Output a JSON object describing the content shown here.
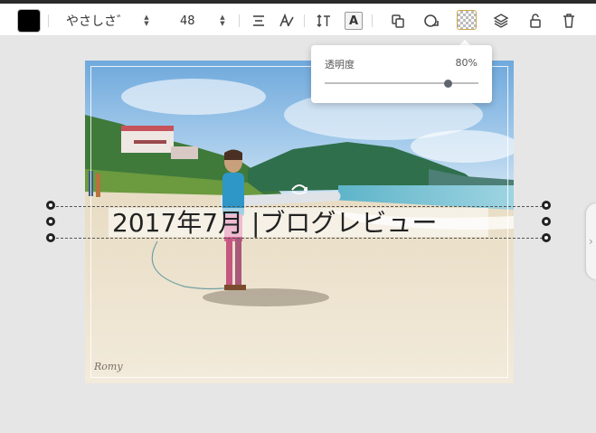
{
  "toolbar": {
    "color": "#000000",
    "font_name": "やさしさ゛",
    "font_size": "48",
    "bold_label": "A"
  },
  "opacity_popup": {
    "label": "透明度",
    "value": "80%",
    "level": 0.8
  },
  "canvas": {
    "text": "2017年7月  |ブログレビュー",
    "signature": "Romy"
  },
  "side_panel": {
    "toggle_glyph": "›"
  }
}
